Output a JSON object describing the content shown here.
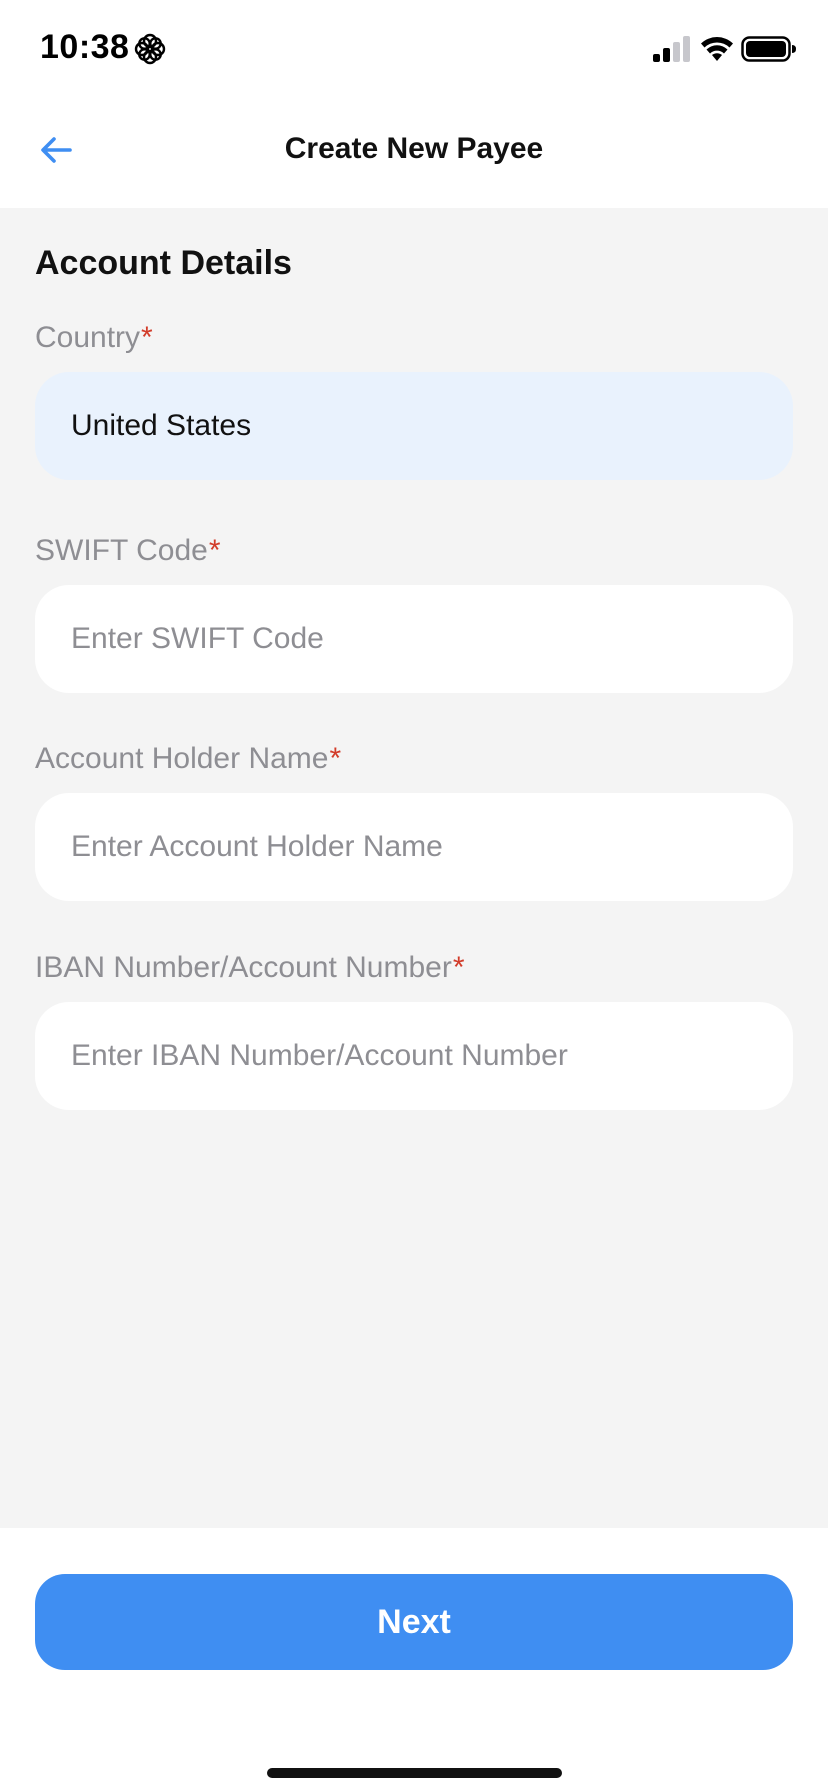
{
  "status_bar": {
    "time": "10:38",
    "icons": [
      "flower-icon",
      "cellular-signal-icon",
      "wifi-icon",
      "battery-icon"
    ]
  },
  "header": {
    "title": "Create New Payee",
    "back_icon": "arrow-left-icon"
  },
  "form": {
    "section_title": "Account Details",
    "required_marker": "*",
    "fields": [
      {
        "label": "Country",
        "value": "United States",
        "placeholder": ""
      },
      {
        "label": "SWIFT Code",
        "value": "",
        "placeholder": "Enter SWIFT Code"
      },
      {
        "label": "Account Holder Name",
        "value": "",
        "placeholder": "Enter Account Holder Name"
      },
      {
        "label": "IBAN Number/Account Number",
        "value": "",
        "placeholder": "Enter IBAN Number/Account Number"
      }
    ]
  },
  "footer": {
    "next_label": "Next"
  },
  "colors": {
    "accent": "#3f8ef2",
    "required": "#d23c2a",
    "selected_field_bg": "#e9f2fd",
    "content_bg": "#f4f4f4",
    "label_gray": "#8e8e93"
  }
}
